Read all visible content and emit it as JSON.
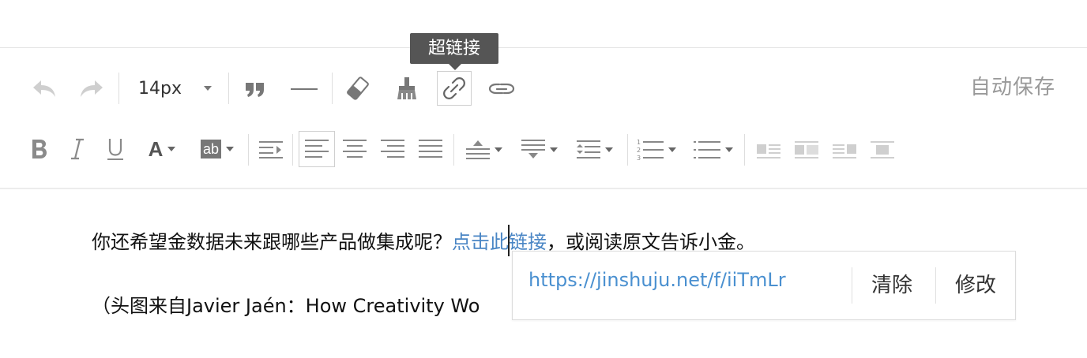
{
  "tooltip": {
    "text": "超链接"
  },
  "toolbar": {
    "font_size": "14px",
    "autosave": "自动保存",
    "icons": {
      "undo": "undo-icon",
      "redo": "redo-icon",
      "quote": "quote-icon",
      "hr": "horizontal-rule-icon",
      "eraser": "eraser-icon",
      "format_painter": "format-painter-icon",
      "link": "link-icon",
      "unlink": "unlink-icon",
      "bold": "bold-icon",
      "italic": "italic-icon",
      "underline": "underline-icon",
      "font_color": "font-color-icon",
      "bg_color": "background-color-icon",
      "indent": "indent-icon",
      "align_left": "align-left-icon",
      "align_center": "align-center-icon",
      "align_right": "align-right-icon",
      "justify": "justify-icon",
      "row_spacing_top": "row-spacing-top-icon",
      "row_spacing_bottom": "row-spacing-bottom-icon",
      "line_height": "line-height-icon",
      "ordered_list": "ordered-list-icon",
      "unordered_list": "unordered-list-icon",
      "image_left": "image-left-icon",
      "image_none": "image-none-icon",
      "image_right": "image-right-icon",
      "image_center": "image-center-icon"
    },
    "bg_color_label": "ab",
    "font_color_label": "A"
  },
  "content": {
    "line1_before": "你还希望金数据未来跟哪些产品做集成呢？",
    "line1_link_a": "点击此",
    "line1_link_b": "链接",
    "line1_after": "，或阅读原文告诉小金。",
    "line2": "（头图来自Javier Jaén：How Creativity Wo"
  },
  "link_popup": {
    "url": "https://jinshuju.net/f/iiTmLr",
    "clear_label": "清除",
    "edit_label": "修改"
  },
  "colors": {
    "link": "#4a86c5",
    "icon_gray": "#888888",
    "icon_light": "#cccccc",
    "tooltip_bg": "#555555"
  }
}
